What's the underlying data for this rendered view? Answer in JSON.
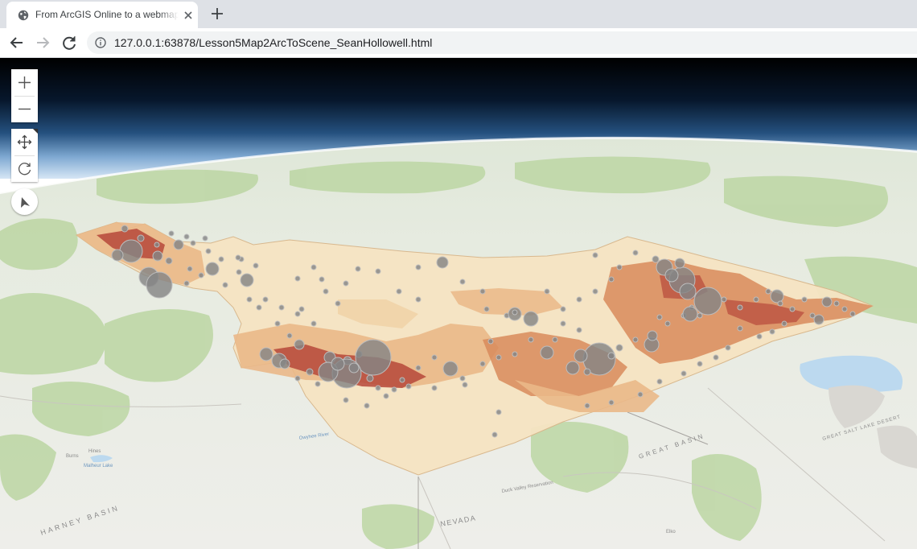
{
  "browser": {
    "tab": {
      "title": "From ArcGIS Online to a webmap",
      "favicon": "globe-icon"
    },
    "new_tab_icon": "plus-icon",
    "address": {
      "url": "127.0.0.1:63878/Lesson5Map2ArcToScene_SeanHollowell.html",
      "icon": "info-icon"
    }
  },
  "scene": {
    "controls": {
      "zoom_in": "zoom-in-icon",
      "zoom_out": "zoom-out-icon",
      "pan": "pan-icon",
      "rotate": "rotate-icon",
      "compass": "compass-icon"
    },
    "map_labels": {
      "nevada": "NEVADA",
      "harney_basin": "HARNEY BASIN",
      "great_basin": "GREAT BASIN",
      "great_salt_lake_desert": "GREAT SALT LAKE DESERT",
      "malheur_lake": "Malheur Lake",
      "burns": "Burns",
      "hines": "Hines",
      "owyhee_river": "Owyhee River",
      "duck_valley": "Duck Valley Reservation",
      "elko": "Elko"
    },
    "colors": {
      "sky_top": "#000000",
      "sky_glow": "#c9dff3",
      "terrain": "#e9ece3",
      "choropleth_low": "#f6e4c3",
      "choropleth_mid": "#eab888",
      "choropleth_high": "#d88b5c",
      "choropleth_max": "#b6483a",
      "points": "#858585"
    }
  }
}
